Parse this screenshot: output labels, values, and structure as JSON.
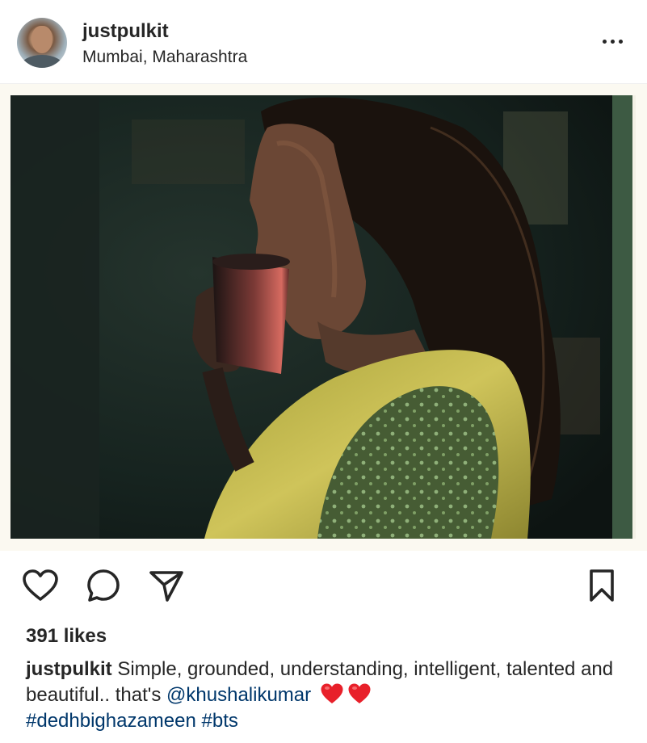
{
  "post": {
    "username": "justpulkit",
    "location": "Mumbai, Maharashtra",
    "likes": "391 likes",
    "caption": {
      "username": "justpulkit",
      "text": "Simple, grounded, understanding, intelligent, talented and beautiful.. that's",
      "mention": "@khushalikumar",
      "hashtags": [
        "#dedhbighazameen",
        "#bts"
      ]
    }
  },
  "icons": {
    "more": "more-options-icon",
    "like": "heart-icon",
    "comment": "comment-icon",
    "share": "send-icon",
    "save": "bookmark-icon"
  },
  "colors": {
    "text": "#262626",
    "link": "#00376b",
    "heart": "#e8202a"
  }
}
